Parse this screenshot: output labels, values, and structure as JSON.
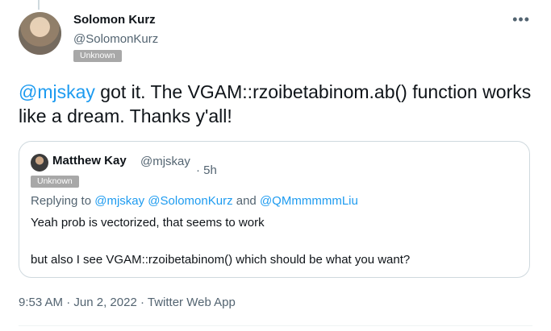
{
  "tweet": {
    "author_name": "Solomon Kurz",
    "author_handle": "@SolomonKurz",
    "badge": "Unknown",
    "more": "•••",
    "mention": "@mjskay",
    "text_rest": " got it. The VGAM::rzoibetabinom.ab() function works like a dream. Thanks y'all!",
    "time": "9:53 AM",
    "date": "Jun 2, 2022",
    "source": "Twitter Web App",
    "sep": "·"
  },
  "quote": {
    "author_name": "Matthew Kay",
    "author_handle": "@mjskay",
    "time": "· 5h",
    "badge": "Unknown",
    "replying_prefix": "Replying to",
    "replying_to": [
      "@mjskay",
      "@SolomonKurz",
      "@QMmmmmmLiu"
    ],
    "and_word": "and",
    "line1": "Yeah prob is vectorized, that seems to work",
    "line2": "but also I see VGAM::rzoibetabinom() which should be what you want?"
  },
  "colors": {
    "accent": "#1d9bf0",
    "secondary_text": "#536471",
    "badge_bg": "#a8a8a8",
    "border": "#cfd9de"
  }
}
